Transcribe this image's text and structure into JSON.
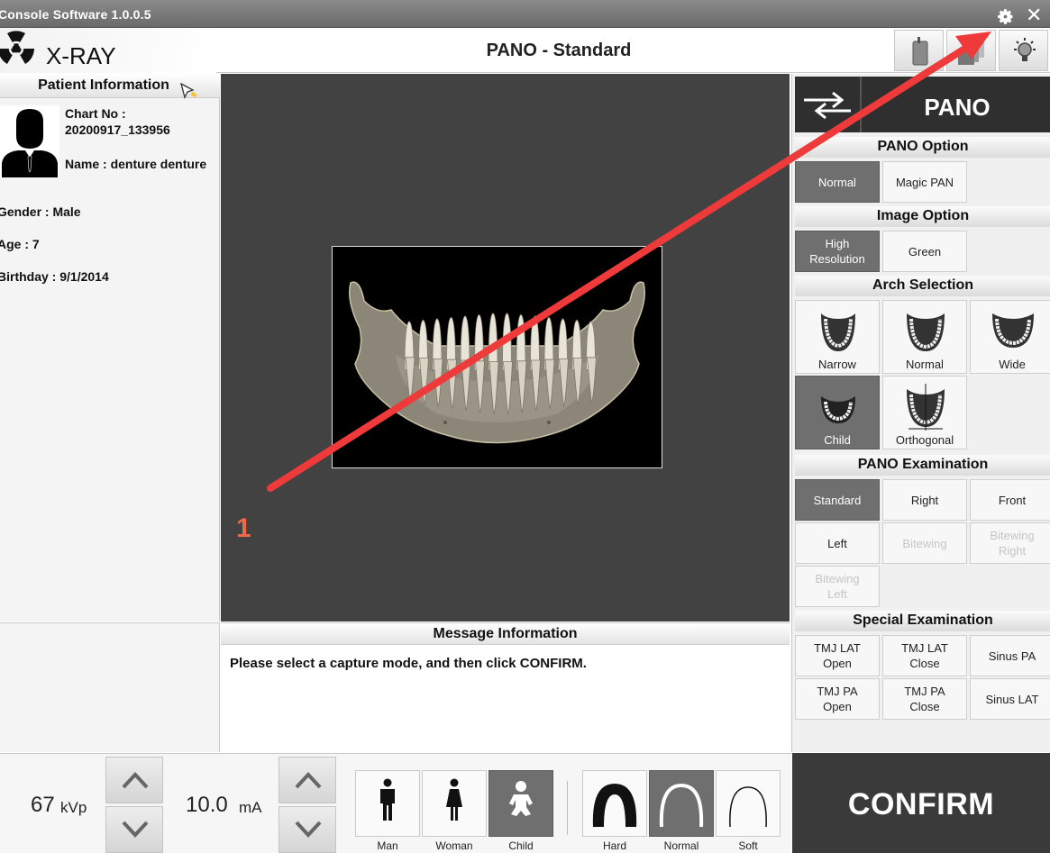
{
  "window": {
    "title": "Console Software  1.0.0.5"
  },
  "header": {
    "app_name": "X-RAY",
    "mode_title": "PANO - Standard"
  },
  "patient": {
    "heading": "Patient Information",
    "chart_no_label": "Chart No :",
    "chart_no": "20200917_133956",
    "name": "Name : denture denture",
    "gender": "Gender : Male",
    "age": "Age : 7",
    "birthday": "Birthday : 9/1/2014"
  },
  "right_panel": {
    "mode_label": "PANO",
    "pano_option": {
      "title": "PANO Option",
      "normal": "Normal",
      "magic": "Magic PAN"
    },
    "image_option": {
      "title": "Image Option",
      "high_res": "High Resolution",
      "green": "Green"
    },
    "arch": {
      "title": "Arch Selection",
      "narrow": "Narrow",
      "normal": "Normal",
      "wide": "Wide",
      "child": "Child",
      "orthogonal": "Orthogonal"
    },
    "exam": {
      "title": "PANO Examination",
      "standard": "Standard",
      "right": "Right",
      "front": "Front",
      "left": "Left",
      "bitewing": "Bitewing",
      "bitewing_right": "Bitewing Right",
      "bitewing_left": "Bitewing Left"
    },
    "special": {
      "title": "Special Examination",
      "tmj_lat_open": "TMJ LAT Open",
      "tmj_lat_close": "TMJ LAT Close",
      "sinus_pa": "Sinus PA",
      "tmj_pa_open": "TMJ PA Open",
      "tmj_pa_close": "TMJ PA Close",
      "sinus_lat": "Sinus LAT"
    }
  },
  "message": {
    "heading": "Message Information",
    "text": "Please select a capture mode, and then click CONFIRM."
  },
  "bottom": {
    "kvp_value": "67",
    "kvp_unit": "kVp",
    "ma_value": "10.0",
    "ma_unit": "mA",
    "patient_types": [
      "Man",
      "Woman",
      "Child"
    ],
    "bone_types": [
      "Hard",
      "Normal",
      "Soft"
    ],
    "confirm": "CONFIRM"
  },
  "annotation": {
    "number": "1",
    "color": "#ee3a3a"
  },
  "colors": {
    "selected": "#6f6f6f",
    "dark": "#2f2f2f"
  }
}
